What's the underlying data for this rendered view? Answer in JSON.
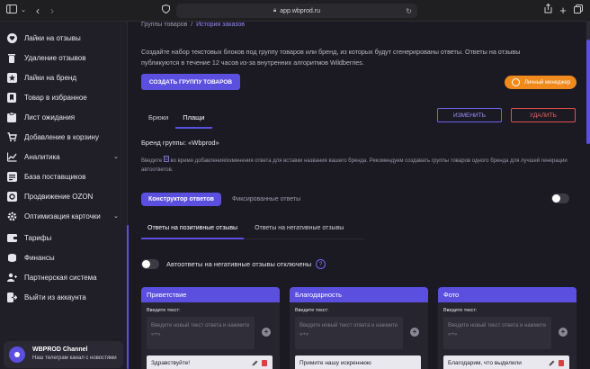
{
  "browser": {
    "url": "app.wbprod.ru"
  },
  "sidebar": {
    "items": [
      {
        "label": "Лайки на отзывы",
        "icon": "heart-icon"
      },
      {
        "label": "Удаление отзывов",
        "icon": "trash-icon"
      },
      {
        "label": "Лайки на бренд",
        "icon": "star-icon"
      },
      {
        "label": "Товар в избранное",
        "icon": "bookmark-icon"
      },
      {
        "label": "Лист ожидания",
        "icon": "clipboard-icon"
      },
      {
        "label": "Добавление в корзину",
        "icon": "cart-icon"
      },
      {
        "label": "Аналитика",
        "icon": "chart-icon",
        "expandable": true
      },
      {
        "label": "База поставщиков",
        "icon": "database-icon"
      },
      {
        "label": "Продвижение OZON",
        "icon": "ozon-icon"
      },
      {
        "label": "Оптимизация карточки",
        "icon": "gear-icon",
        "expandable": true
      },
      {
        "label": "Тарифы",
        "icon": "wallet-icon"
      },
      {
        "label": "Финансы",
        "icon": "coins-icon"
      },
      {
        "label": "Партнерская система",
        "icon": "partners-icon"
      },
      {
        "label": "Выйти из аккаунта",
        "icon": "logout-icon"
      }
    ],
    "promo": {
      "title": "WBPROD Channel",
      "subtitle": "Наш телеграм канал с новостями"
    }
  },
  "main": {
    "breadcrumbs": {
      "parent": "Группы товаров",
      "separator": "/",
      "current": "История заказов"
    },
    "intro": "Создайте набор текстовых блоков под группу товаров или бренд, из которых будут сгенерированы ответы. Ответы на отзывы публикуются в течение 12 часов из-за внутренних алгоритмов Wildberries.",
    "create_button": "СОЗДАТЬ ГРУППУ ТОВАРОВ",
    "manager_button": "Личный менеджер",
    "tabs": [
      "Брюки",
      "Плащи"
    ],
    "edit_button": "ИЗМЕНИТЬ",
    "delete_button": "УДАЛИТЬ",
    "brand_label": "Бренд группы: «Wbprod»",
    "hint_before": "Введите",
    "hint_after": "во время добавления/изменения ответа для вставки названия вашего бренда. Рекомендуем создавать группы товаров одного бренда для лучшей генерации автоответов.",
    "mode_pills": [
      "Конструктор ответов",
      "Фиксированные ответы"
    ],
    "sub_tabs": [
      "Ответы на позитивные отзывы",
      "Ответы на негативные отзывы"
    ],
    "autoreply_label": "Автоответы на негативные отзывы отключены",
    "help_mark": "?",
    "cards": [
      {
        "title": "Приветствие",
        "input_label": "Введите текст:",
        "placeholder": "Введите новый текст ответа и нажмите «+»",
        "response": "Здравствуйте!"
      },
      {
        "title": "Благодарность",
        "input_label": "Введите текст:",
        "placeholder": "Введите новый текст ответа и нажмите «+»",
        "response": "Примите нашу искреннюю"
      },
      {
        "title": "Фото",
        "input_label": "Введите текст:",
        "placeholder": "Введите новый текст ответа и нажмите «+»",
        "response": "Благодарим, что выделили"
      }
    ],
    "add_mark": "+"
  },
  "colors": {
    "accent": "#5b4fe0",
    "danger": "#e04f4f",
    "orange": "#f08a1c",
    "background": "#1b1a23"
  }
}
